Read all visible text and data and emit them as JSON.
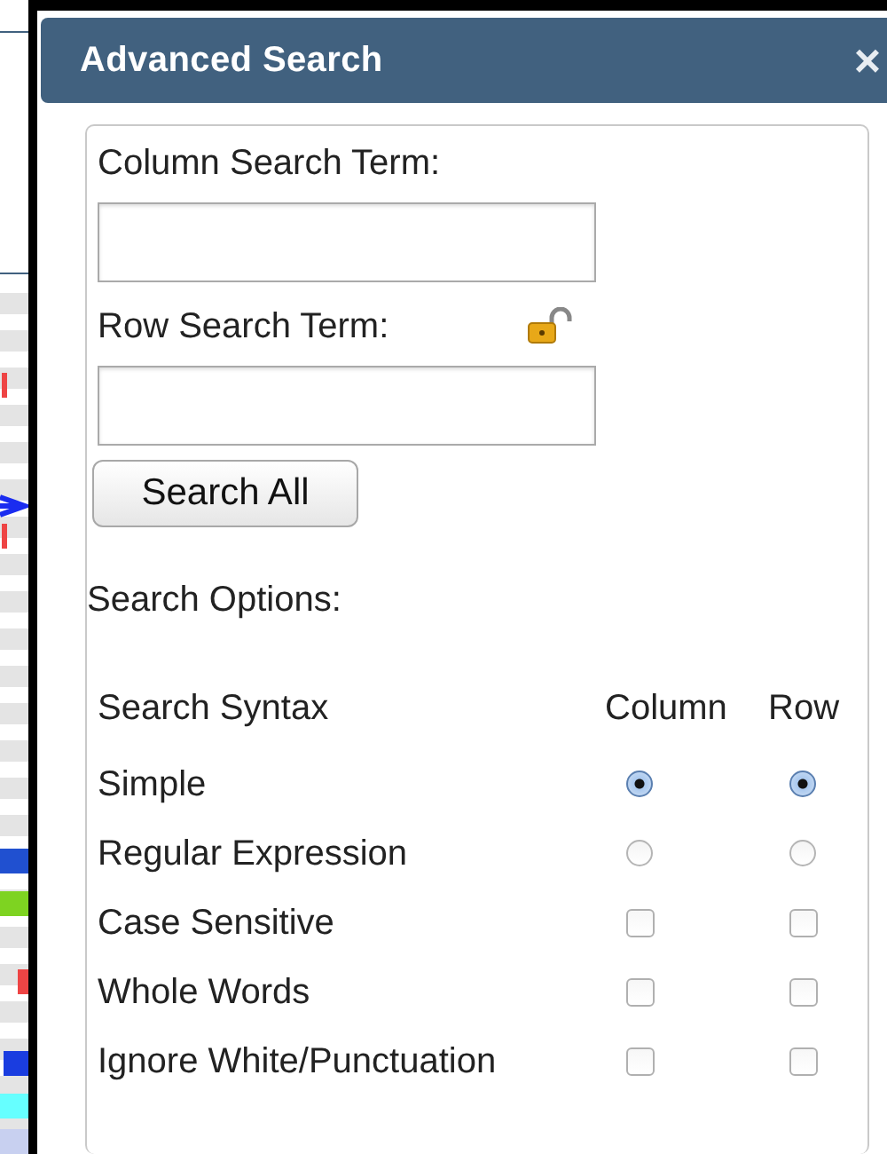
{
  "dialog": {
    "title": "Advanced Search",
    "close": "×"
  },
  "column_search": {
    "label": "Column Search Term:"
  },
  "row_search": {
    "label": "Row Search Term:"
  },
  "search_button": "Search All",
  "options_heading": "Search Options:",
  "options_table": {
    "columns": [
      "Search Syntax",
      "Column",
      "Row"
    ],
    "rows": [
      {
        "label": "Simple",
        "kind": "radio",
        "column": {
          "selected": true
        },
        "row": {
          "selected": true
        }
      },
      {
        "label": "Regular Expression",
        "kind": "radio",
        "column": {
          "selected": false
        },
        "row": {
          "selected": false
        }
      },
      {
        "label": "Case Sensitive",
        "kind": "checkbox",
        "column": {
          "checked": false
        },
        "row": {
          "checked": false
        }
      },
      {
        "label": "Whole Words",
        "kind": "checkbox",
        "column": {
          "checked": false
        },
        "row": {
          "checked": false
        }
      },
      {
        "label": "Ignore White/Punctuation",
        "kind": "checkbox",
        "column": {
          "checked": false
        },
        "row": {
          "checked": false
        }
      }
    ]
  }
}
